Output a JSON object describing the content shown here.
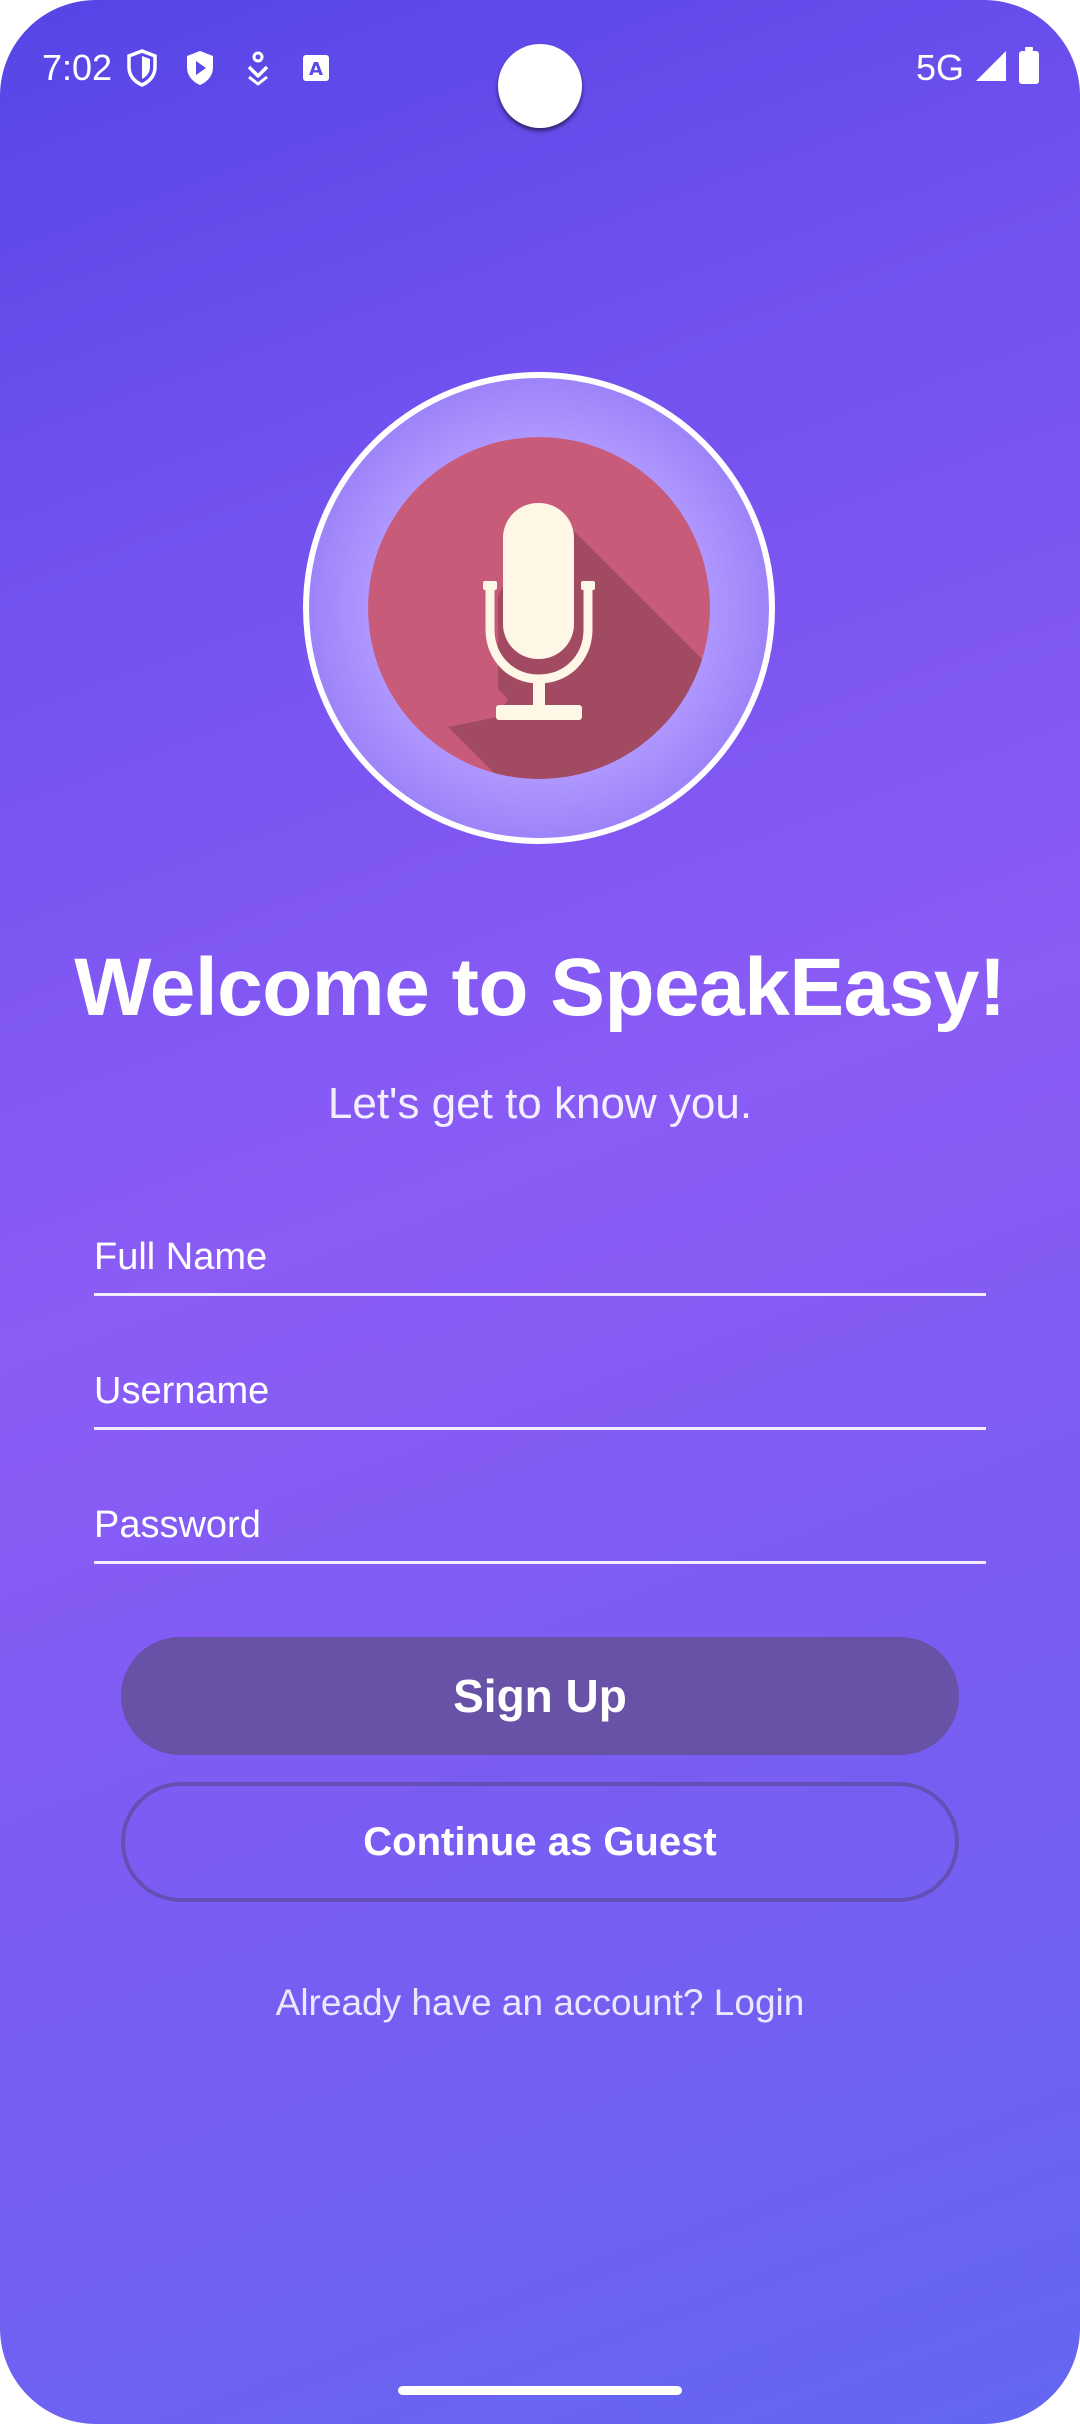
{
  "status_bar": {
    "time": "7:02",
    "network": "5G",
    "left_icons": [
      "shield-icon",
      "play-shield-icon",
      "location-person-icon",
      "translate-icon"
    ],
    "right_icons": [
      "signal-icon",
      "battery-icon"
    ]
  },
  "logo": {
    "icon": "microphone-icon",
    "disc_color": "#c85a7a",
    "mic_color": "#fff7e6"
  },
  "welcome": {
    "title": "Welcome to SpeakEasy!",
    "subtitle": "Let's get to know you."
  },
  "form": {
    "full_name": {
      "placeholder": "Full Name",
      "value": ""
    },
    "username": {
      "placeholder": "Username",
      "value": ""
    },
    "password": {
      "placeholder": "Password",
      "value": ""
    }
  },
  "buttons": {
    "signup_label": "Sign Up",
    "guest_label": "Continue as Guest"
  },
  "footer": {
    "login_text": "Already have an account? Login"
  },
  "colors": {
    "background_gradient": [
      "#5545e6",
      "#8b5cf6",
      "#6366f1"
    ],
    "signup_button": "#6752a8",
    "guest_border": "#6450b4"
  }
}
